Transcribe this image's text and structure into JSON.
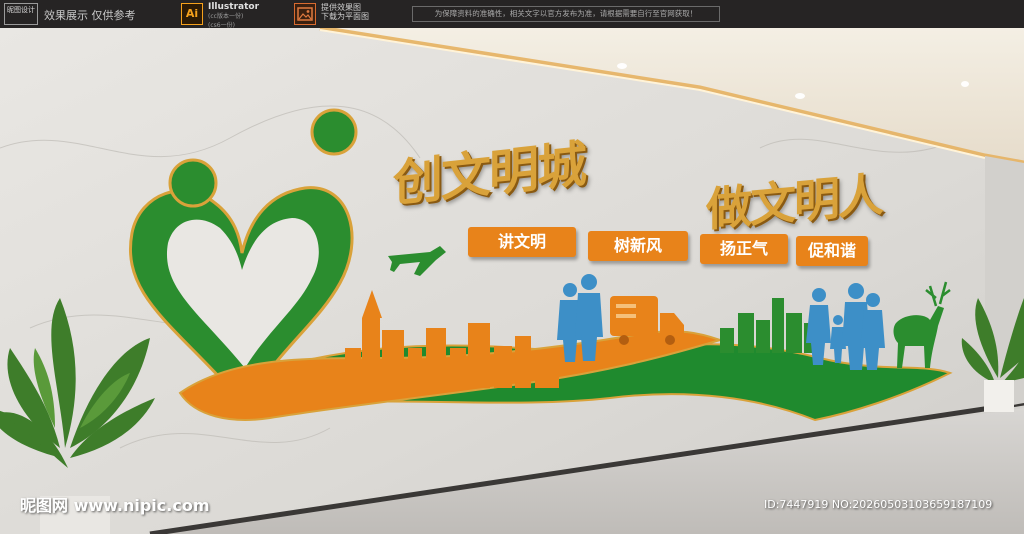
{
  "topbar": {
    "logo_text": "昵图设计",
    "effect_label": "效果展示 仅供参考",
    "ai_icon_text": "Ai",
    "ai_title": "Illustrator",
    "ai_version_1": "(cc版本一份)",
    "ai_version_2": "(cs6一份)",
    "image_line_1": "提供效果图",
    "image_line_2": "下载为平面图",
    "notice": "为保障资料的准确性，相关文字以官方发布为准，请根据需要自行至官网获取！"
  },
  "wall": {
    "title_left": "创文明城",
    "title_right": "做文明人",
    "slogans": [
      "讲文明",
      "树新风",
      "扬正气",
      "促和谐"
    ]
  },
  "colors": {
    "green": "#1f8a2e",
    "orange": "#e8831a",
    "gold": "#d9a23a",
    "blue": "#3d8fc7"
  },
  "icons": [
    "heart-people-logo-icon",
    "airplane-icon",
    "truck-icon",
    "deer-icon",
    "plant-icon"
  ],
  "watermark": {
    "site": "昵图网 www.nipic.com",
    "id": "ID:7447919 NO:20260503103659187109"
  }
}
